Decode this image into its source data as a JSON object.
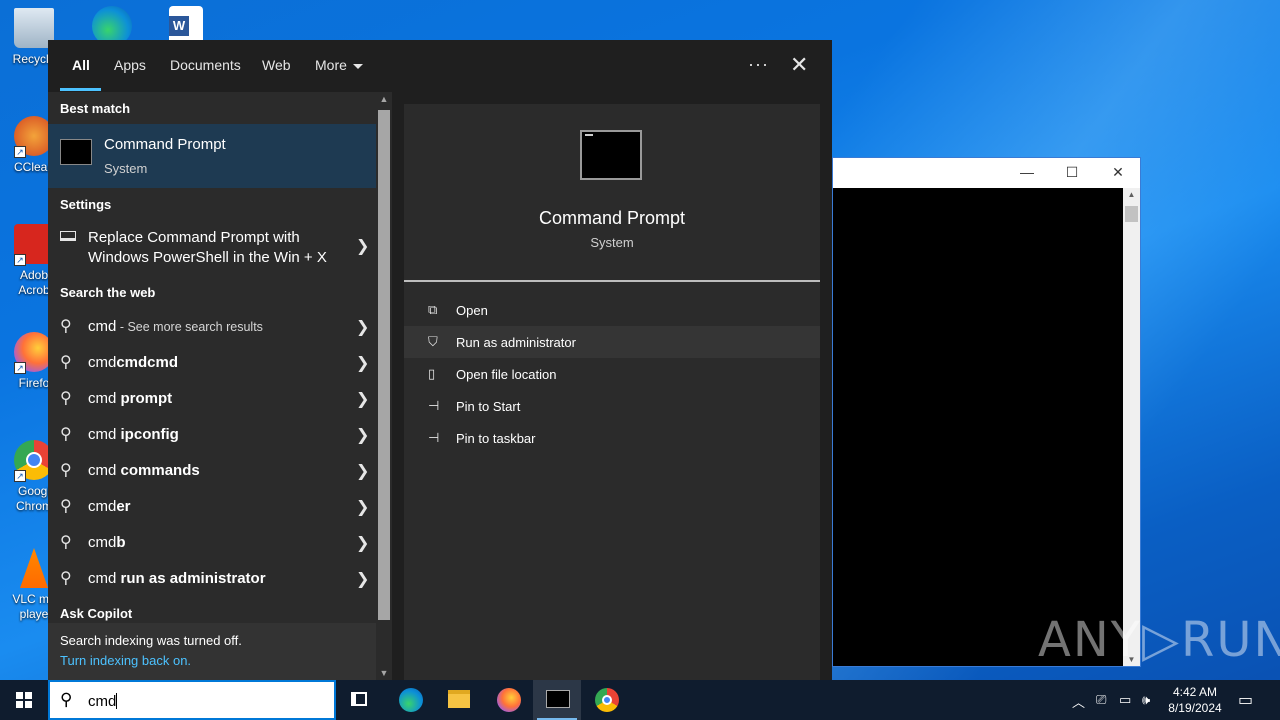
{
  "desktop": {
    "icons": [
      {
        "label": "Recycle"
      },
      {
        "label": "CClean"
      },
      {
        "label": "Adob Acrob"
      },
      {
        "label": "Firefo"
      },
      {
        "label": "Googl Chrom"
      },
      {
        "label": "VLC me playe"
      }
    ]
  },
  "search_panel": {
    "tabs": [
      "All",
      "Apps",
      "Documents",
      "Web",
      "More"
    ],
    "dots": "···",
    "close": "✕",
    "best_match_heading": "Best match",
    "best_match": {
      "title": "Command Prompt",
      "subtitle": "System"
    },
    "settings_heading": "Settings",
    "settings_item": "Replace Command Prompt with Windows PowerShell in the Win + X",
    "web_heading": "Search the web",
    "web_first": {
      "prefix": "cmd",
      "suffix": " - See more search results"
    },
    "web_items": [
      {
        "plain": "cmd",
        "bold": "cmdcmd"
      },
      {
        "plain": "cmd ",
        "bold": "prompt"
      },
      {
        "plain": "cmd ",
        "bold": "ipconfig"
      },
      {
        "plain": "cmd ",
        "bold": "commands"
      },
      {
        "plain": "cmd",
        "bold": "er"
      },
      {
        "plain": "cmd",
        "bold": "b"
      },
      {
        "plain": "cmd ",
        "bold": "run as administrator"
      }
    ],
    "copilot_heading": "Ask Copilot",
    "indexing_line1": "Search indexing was turned off.",
    "indexing_line2": "Turn indexing back on.",
    "preview": {
      "title": "Command Prompt",
      "subtitle": "System",
      "actions": [
        "Open",
        "Run as administrator",
        "Open file location",
        "Pin to Start",
        "Pin to taskbar"
      ]
    }
  },
  "taskbar": {
    "search_value": "cmd",
    "clock_time": "4:42 AM",
    "clock_date": "8/19/2024"
  },
  "watermark": "ANY▷RUN",
  "colors": {
    "accent": "#4cc2ff",
    "best_match_bg": "#1e3a52",
    "panel_bg": "#2b2b2b"
  }
}
